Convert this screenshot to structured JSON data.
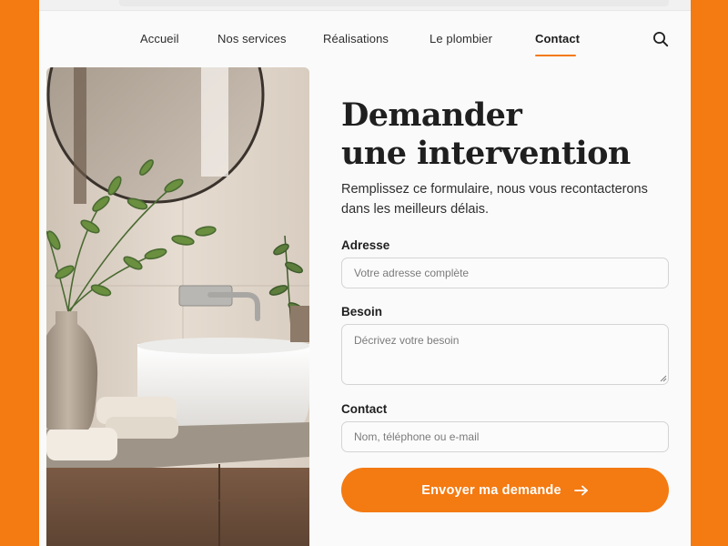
{
  "nav": {
    "items": [
      {
        "label": "Accueil",
        "active": false
      },
      {
        "label": "Nos services",
        "active": false
      },
      {
        "label": "Réalisations",
        "active": false
      },
      {
        "label": "Le plombier",
        "active": false
      },
      {
        "label": "Contact",
        "active": true
      }
    ],
    "search_icon": "search-icon"
  },
  "hero_image": {
    "subject": "bathroom vanity with round mirror, white basin, wall faucet, plants and towels"
  },
  "form": {
    "title_line1": "Demander",
    "title_line2": "une intervention",
    "subtitle": "Remplissez ce formulaire, nous vous recontacterons dans les meilleurs délais.",
    "fields": {
      "address": {
        "label": "Adresse",
        "placeholder": "Votre adresse complète",
        "value": ""
      },
      "need": {
        "label": "Besoin",
        "placeholder": "Décrivez votre besoin",
        "value": ""
      },
      "contact": {
        "label": "Contact",
        "placeholder": "Nom, téléphone ou e-mail",
        "value": ""
      }
    },
    "submit_label": "Envoyer ma demande",
    "submit_icon": "arrow-right-icon"
  },
  "colors": {
    "accent": "#f47a12",
    "page_bg": "#fafafa",
    "text": "#1f1f1f"
  }
}
